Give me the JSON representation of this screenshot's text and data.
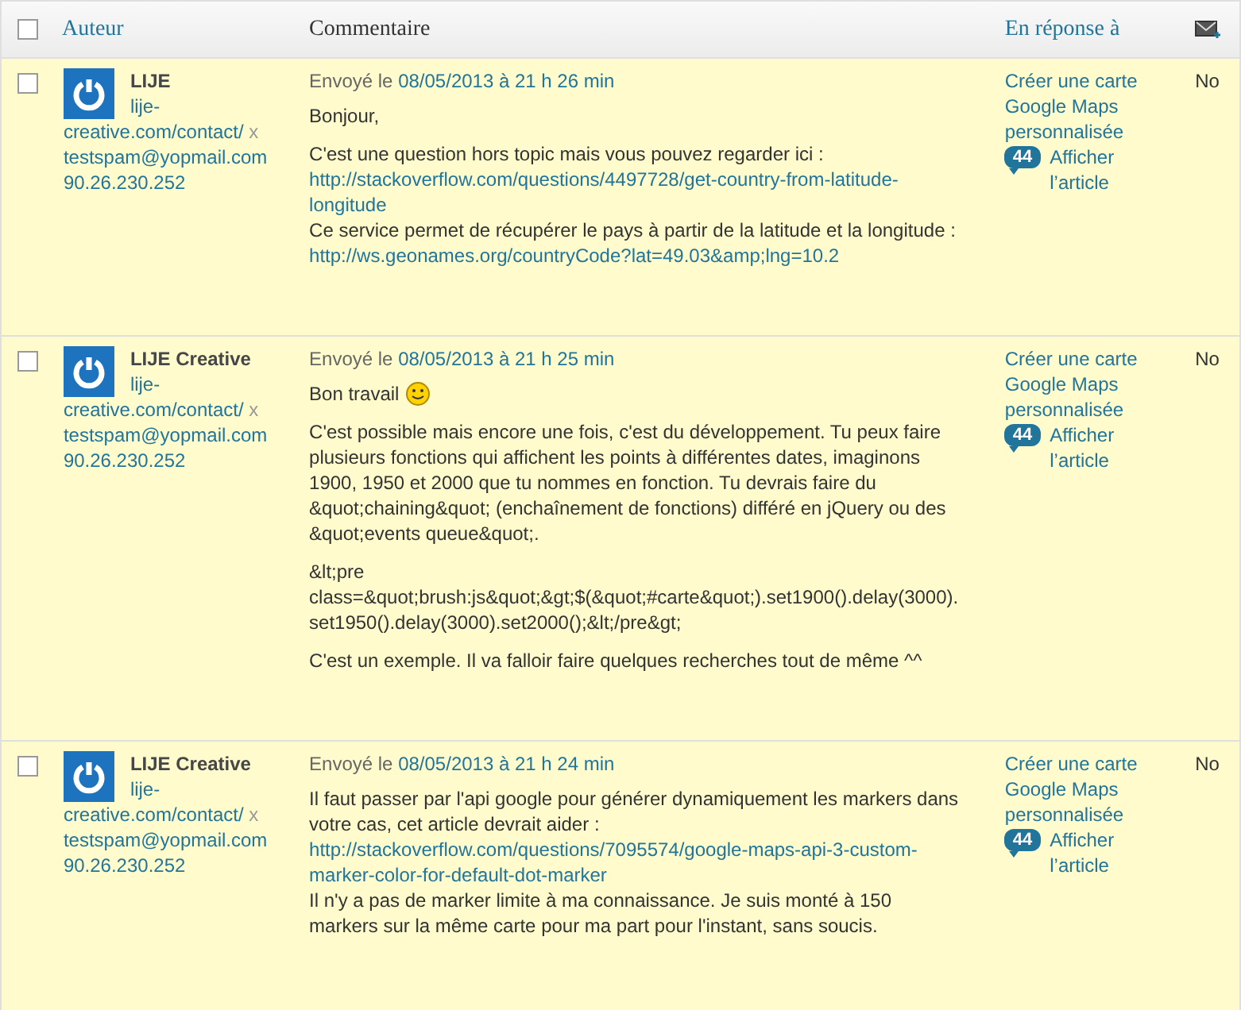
{
  "header": {
    "select_all": {
      "checked": false
    },
    "columns": [
      {
        "label": "Auteur",
        "kind": "link"
      },
      {
        "label": "Commentaire",
        "kind": "plain"
      },
      {
        "label": "En réponse à",
        "kind": "link"
      },
      {
        "kind": "mail-icon"
      }
    ]
  },
  "comments": [
    {
      "checked": false,
      "author": "LIJE",
      "url": [
        "lije-",
        "creative.com/contact/"
      ],
      "remove": "x",
      "email": "testspam@yopmail.com",
      "ip": "90.26.230.252",
      "sent_prefix": "Envoyé le",
      "sent_date": "08/05/2013 à 21 h 26 min",
      "paragraphs": [
        {
          "lines": [
            {
              "kind": "text",
              "text": "Bonjour,"
            }
          ]
        },
        {
          "lines": [
            {
              "kind": "text",
              "text": "C'est une question hors topic mais vous pouvez regarder ici :"
            },
            {
              "kind": "link",
              "text": "http://stackoverflow.com/questions/4497728/get-country-from-latitude-"
            },
            {
              "kind": "link",
              "text": "longitude"
            },
            {
              "kind": "text",
              "text": "Ce service permet de récupérer le pays à partir de la latitude et la longitude :"
            },
            {
              "kind": "link",
              "text": "http://ws.geonames.org/countryCode?lat=49.03&amp;lng=10.2"
            }
          ]
        }
      ],
      "post": "Créer une carte Google Maps personnalisée",
      "count": "44",
      "view": "Afficher l’article",
      "last": "No"
    },
    {
      "checked": false,
      "author": "LIJE Creative",
      "url": [
        "lije-",
        "creative.com/contact/"
      ],
      "remove": "x",
      "email": "testspam@yopmail.com",
      "ip": "90.26.230.252",
      "sent_prefix": "Envoyé le",
      "sent_date": "08/05/2013 à 21 h 25 min",
      "paragraphs": [
        {
          "smiley": true,
          "lines": [
            {
              "kind": "text",
              "text": "Bon travail"
            }
          ]
        },
        {
          "lines": [
            {
              "kind": "text",
              "text": "C'est possible mais encore une fois, c'est du développement. Tu peux faire plusieurs fonctions qui affichent les points à différentes dates, imaginons 1900, 1950 et 2000 que tu nommes en fonction. Tu devrais faire du &quot;chaining&quot; (enchaînement de fonctions) différé en jQuery ou des &quot;events queue&quot;."
            }
          ]
        },
        {
          "lines": [
            {
              "kind": "text",
              "text": "&lt;pre"
            },
            {
              "kind": "text",
              "text": "class=&quot;brush:js&quot;&gt;$(&quot;#carte&quot;).set1900().delay(3000)."
            },
            {
              "kind": "text",
              "text": "set1950().delay(3000).set2000();&lt;/pre&gt;"
            }
          ]
        },
        {
          "lines": [
            {
              "kind": "text",
              "text": "C'est un exemple. Il va falloir faire quelques recherches tout de même ^^"
            }
          ]
        }
      ],
      "post": "Créer une carte Google Maps personnalisée",
      "count": "44",
      "view": "Afficher l’article",
      "last": "No"
    },
    {
      "checked": false,
      "author": "LIJE Creative",
      "url": [
        "lije-",
        "creative.com/contact/"
      ],
      "remove": "x",
      "email": "testspam@yopmail.com",
      "ip": "90.26.230.252",
      "sent_prefix": "Envoyé le",
      "sent_date": "08/05/2013 à 21 h 24 min",
      "paragraphs": [
        {
          "lines": [
            {
              "kind": "text",
              "text": "Il faut passer par l'api google pour générer dynamiquement les markers dans votre cas, cet article devrait aider :"
            },
            {
              "kind": "link",
              "text": "http://stackoverflow.com/questions/7095574/google-maps-api-3-custom-"
            },
            {
              "kind": "link",
              "text": "marker-color-for-default-dot-marker"
            },
            {
              "kind": "text",
              "text": "Il n'y a pas de marker limite à ma connaissance. Je suis monté à 150 markers sur la même carte pour ma part pour l'instant, sans soucis."
            }
          ]
        }
      ],
      "post": "Créer une carte Google Maps personnalisée",
      "count": "44",
      "view": "Afficher l’article",
      "last": "No"
    }
  ]
}
